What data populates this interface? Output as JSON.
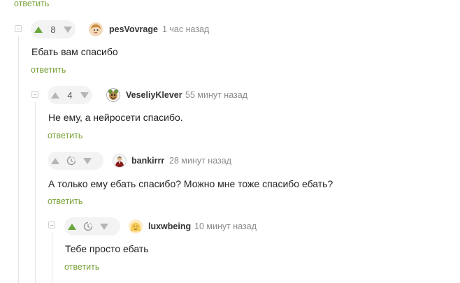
{
  "top_reply": "ответить",
  "comments": [
    {
      "rating": "8",
      "username": "pesVovrage",
      "time": "1 час назад",
      "text": "Ебать вам спасибо",
      "reply": "ответить"
    },
    {
      "rating": "4",
      "username": "VeseliyKlever",
      "time": "55 минут назад",
      "text": "Не ему, а нейросети спасибо.",
      "reply": "ответить"
    },
    {
      "username": "bankirrr",
      "time": "28 минут назад",
      "text": "А только ему ебать спасибо? Можно мне тоже спасибо ебать?",
      "reply": "ответить"
    },
    {
      "username": "luxwbeing",
      "time": "10 минут назад",
      "text": "Тебе просто ебать",
      "reply": "ответить"
    }
  ],
  "colors": {
    "accent_green": "#6aa83a",
    "link_green": "#7aa33a",
    "pill_bg": "#f3f3f3"
  }
}
